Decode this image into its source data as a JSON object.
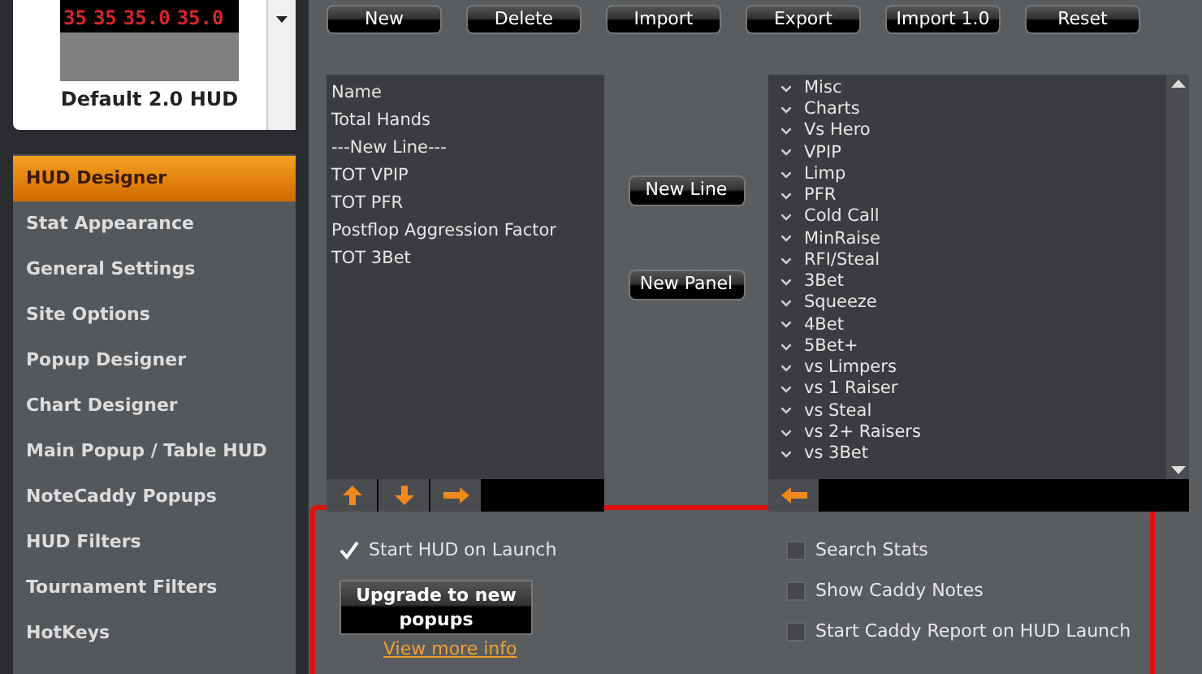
{
  "hud_preview": {
    "stats": [
      "35",
      "35",
      "35.0",
      "35.0"
    ],
    "name": "Default 2.0 HUD"
  },
  "sidebar": {
    "items": [
      {
        "label": "HUD Designer",
        "selected": true
      },
      {
        "label": "Stat Appearance",
        "selected": false
      },
      {
        "label": "General Settings",
        "selected": false
      },
      {
        "label": "Site Options",
        "selected": false
      },
      {
        "label": "Popup Designer",
        "selected": false
      },
      {
        "label": "Chart Designer",
        "selected": false
      },
      {
        "label": "Main Popup / Table HUD",
        "selected": false
      },
      {
        "label": "NoteCaddy Popups",
        "selected": false
      },
      {
        "label": "HUD Filters",
        "selected": false
      },
      {
        "label": "Tournament Filters",
        "selected": false
      },
      {
        "label": "HotKeys",
        "selected": false
      }
    ]
  },
  "toolbar": [
    "New",
    "Delete",
    "Import",
    "Export",
    "Import 1.0",
    "Reset"
  ],
  "hud_lines": [
    "Name",
    "Total Hands",
    "---New Line---",
    "TOT VPIP",
    "TOT PFR",
    "Postflop Aggression Factor",
    "TOT 3Bet"
  ],
  "middle_buttons": [
    "New Line",
    "New Panel"
  ],
  "stat_categories": [
    "Misc",
    "Charts",
    "Vs Hero",
    "VPIP",
    "Limp",
    "PFR",
    "Cold Call",
    "MinRaise",
    "RFI/Steal",
    "3Bet",
    "Squeeze",
    "4Bet",
    "5Bet+",
    "vs Limpers",
    "vs 1 Raiser",
    "vs Steal",
    "vs 2+ Raisers",
    "vs 3Bet"
  ],
  "options_left": {
    "checkbox": {
      "label": "Start HUD on Launch",
      "checked": true
    },
    "upgrade_button": "Upgrade to new popups",
    "link": "View more info"
  },
  "options_right": [
    {
      "label": "Search Stats",
      "checked": false
    },
    {
      "label": "Show Caddy Notes",
      "checked": false
    },
    {
      "label": "Start Caddy Report on HUD Launch",
      "checked": false
    }
  ]
}
